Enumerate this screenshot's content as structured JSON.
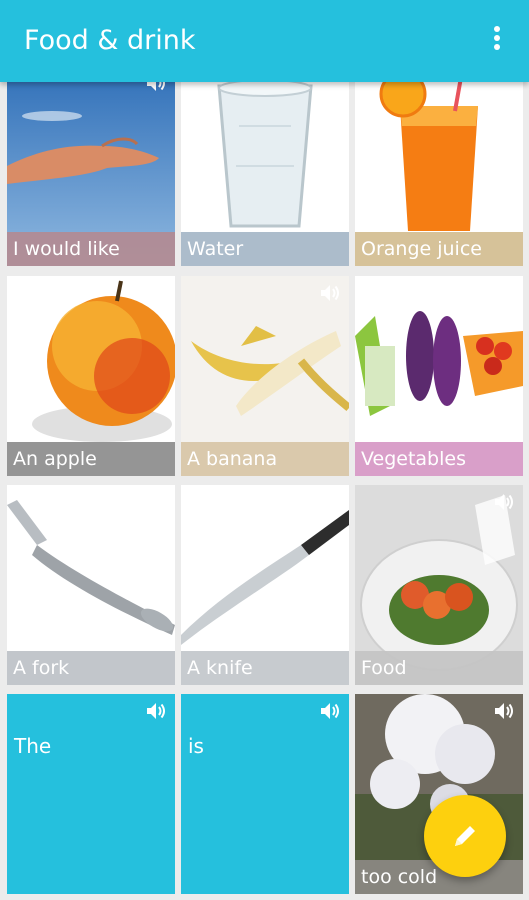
{
  "app_bar": {
    "title": "Food & drink",
    "menu_icon": "more-vert-icon"
  },
  "tiles": [
    {
      "caption": "I would like",
      "caption_color": "#b48a90",
      "icon": "hand-icon"
    },
    {
      "caption": "Water",
      "caption_color": "#a8b8c8",
      "icon": "glass-of-water-icon"
    },
    {
      "caption": "Orange juice",
      "caption_color": "#d4bf94",
      "icon": "orange-juice-icon"
    },
    {
      "caption": "An apple",
      "caption_color": "#8f8f8f",
      "icon": "apple-icon"
    },
    {
      "caption": "A banana",
      "caption_color": "#d8c6a8",
      "icon": "banana-icon"
    },
    {
      "caption": "Vegetables",
      "caption_color": "#d79ac6",
      "icon": "vegetables-icon"
    },
    {
      "caption": "A fork",
      "caption_color": "#bfc3c8",
      "icon": "fork-icon"
    },
    {
      "caption": "A knife",
      "caption_color": "#c4c8cc",
      "icon": "knife-icon"
    },
    {
      "caption": "Food",
      "caption_color": "#c4c4c4",
      "icon": "plate-of-food-icon"
    },
    {
      "word": "The",
      "color": "#25c0dd"
    },
    {
      "word": "is",
      "color": "#25c0dd"
    },
    {
      "caption": "too cold",
      "caption_color": "#8e8a86",
      "icon": "frost-branch-icon"
    }
  ],
  "speaker_icon": "speaker-icon",
  "fab": {
    "icon": "pencil-icon",
    "color": "#fdd00e"
  }
}
